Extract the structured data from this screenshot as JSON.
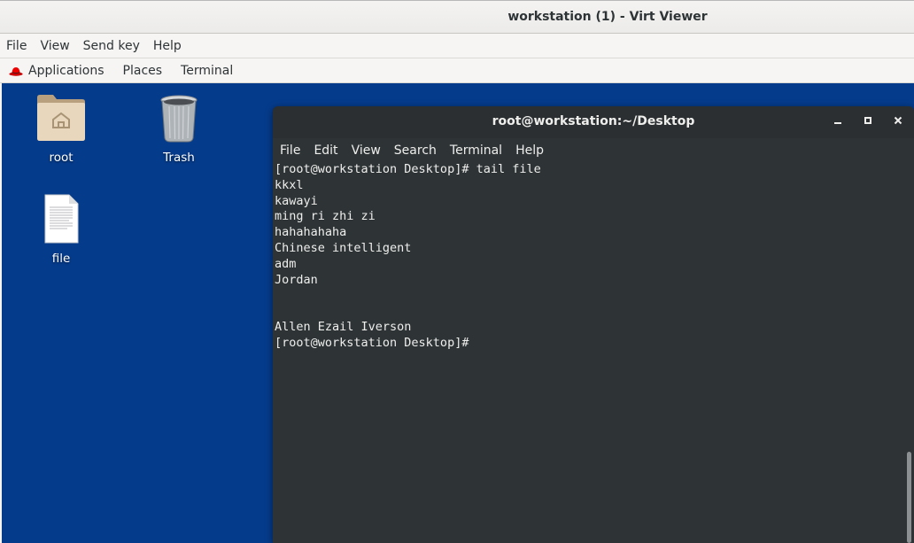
{
  "window": {
    "title": "workstation (1) - Virt Viewer"
  },
  "vv_menu": [
    "File",
    "View",
    "Send key",
    "Help"
  ],
  "panel": {
    "applications": "Applications",
    "places": "Places",
    "terminal": "Terminal"
  },
  "desktop": {
    "icons": {
      "root": "root",
      "trash": "Trash",
      "file": "file"
    },
    "background_color": "#053b8b"
  },
  "terminal": {
    "title": "root@workstation:~/Desktop",
    "menu": [
      "File",
      "Edit",
      "View",
      "Search",
      "Terminal",
      "Help"
    ],
    "lines": [
      "[root@workstation Desktop]# tail file",
      "kkxl",
      "kawayi",
      "ming ri zhi zi",
      "hahahahaha",
      "Chinese intelligent",
      "adm",
      "Jordan",
      "",
      "",
      "Allen Ezail Iverson",
      "[root@workstation Desktop]#"
    ]
  }
}
